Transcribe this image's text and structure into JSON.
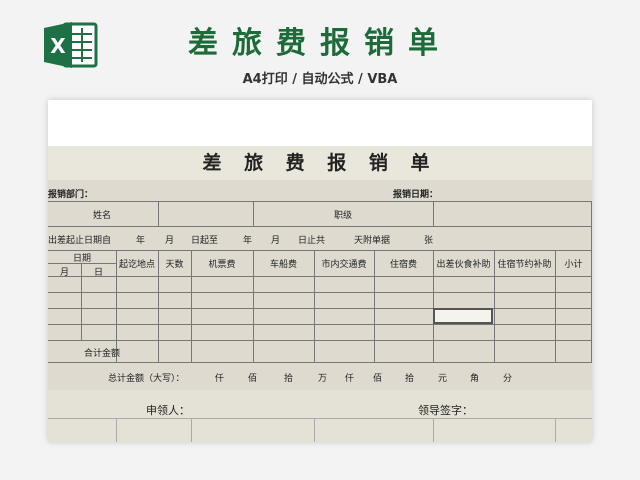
{
  "banner": {
    "title": "差旅费报销单",
    "subtitle": "A4打印 / 自动公式 / VBA",
    "logo_icon": "excel-logo-icon",
    "logo_color": "#1e7145"
  },
  "form": {
    "title": "差 旅 费 报 销 单",
    "dept_label": "报销部门：",
    "date_label": "报销日期：",
    "name_label": "姓名",
    "rank_label": "职级",
    "period_text": [
      "出差起止日期自",
      "年",
      "月",
      "日起至",
      "年",
      "月",
      "日止共",
      "天附单据",
      "张"
    ],
    "date_header": "日期",
    "month_label": "月",
    "day_label": "日",
    "columns": [
      "起讫地点",
      "天数",
      "机票费",
      "车船费",
      "市内交通费",
      "住宿费",
      "出差伙食补助",
      "住宿节约补助",
      "小计"
    ],
    "subtotal_label": "合计金额",
    "total_text": [
      "总计金额（大写）：",
      "仟",
      "佰",
      "拾",
      "万",
      "仟",
      "佰",
      "拾",
      "元",
      "角",
      "分"
    ],
    "applicant_label": "申领人：",
    "leader_label": "领导签字："
  },
  "colors": {
    "form_bg": "#dedad0",
    "title_green": "#1e6b3a"
  }
}
